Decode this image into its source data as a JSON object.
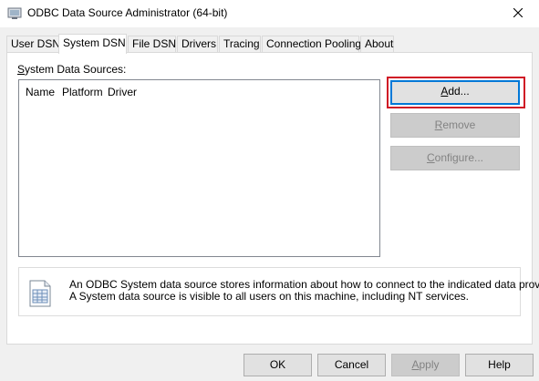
{
  "window": {
    "title": "ODBC Data Source Administrator (64-bit)",
    "app_icon": "odbc-admin-icon",
    "close_icon": "close-icon"
  },
  "tabs": [
    {
      "label": "User DSN",
      "active": false
    },
    {
      "label": "System DSN",
      "active": true
    },
    {
      "label": "File DSN",
      "active": false
    },
    {
      "label": "Drivers",
      "active": false
    },
    {
      "label": "Tracing",
      "active": false
    },
    {
      "label": "Connection Pooling",
      "active": false
    },
    {
      "label": "About",
      "active": false
    }
  ],
  "system_dsn": {
    "group_label_mnemonic": "S",
    "group_label_rest": "ystem Data Sources:",
    "columns": [
      "Name",
      "Platform",
      "Driver"
    ],
    "rows": [],
    "buttons": {
      "add_mnemonic": "A",
      "add_rest": "dd...",
      "remove_mnemonic": "R",
      "remove_rest": "emove",
      "configure_mnemonic": "C",
      "configure_rest": "onfigure..."
    },
    "info_icon": "data-source-icon",
    "info_line1": "An ODBC System data source stores information about how to connect to the indicated data provider.",
    "info_line2": "A System data source is visible to all users on this machine, including NT services."
  },
  "footer": {
    "ok": "OK",
    "cancel": "Cancel",
    "apply_mnemonic": "A",
    "apply_rest": "pply",
    "help": "Help"
  },
  "colors": {
    "highlight_red": "#d01825",
    "focus_blue": "#0078d7"
  }
}
